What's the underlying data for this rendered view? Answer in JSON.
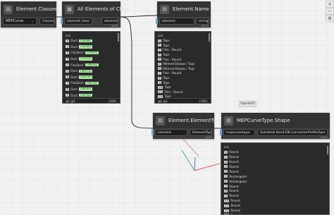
{
  "canvas": {
    "background": "#f1f1f1",
    "grid_line": "#e4e4e4",
    "wire_color": "#1a1a1a",
    "port_color": "#6aa6d9",
    "axis_colors": {
      "x": "#e03030",
      "y": "#30a050",
      "z": "#3050e0"
    }
  },
  "zoom_controls": [
    {
      "name": "zoom-in-icon",
      "glyph": "+"
    },
    {
      "name": "zoom-out-icon",
      "glyph": "−"
    },
    {
      "name": "fit-view-icon",
      "glyph": "⊕"
    }
  ],
  "tooltip": "OpenHEP",
  "nodes": {
    "element_classes": {
      "title": "Element Classes",
      "value": "MEPCurve",
      "output": "Classes"
    },
    "all_elements": {
      "title": "All Elements of Class",
      "input": "element class",
      "output": "elements",
      "lacing": "AUTO"
    },
    "element_name": {
      "title": "Element.Name",
      "input": "element",
      "output": "string",
      "lacing": "AUTO"
    },
    "element_type": {
      "title": "Element.ElementType",
      "input": "element",
      "output": "ElementType",
      "lacing": "AUTO"
    },
    "mep_shape": {
      "title": "MEPCurveType.Shape",
      "input": "mepcurvetype",
      "output": "Autodesk.Revit.DB.ConnectorProfileType",
      "lacing": "AUTO"
    }
  },
  "previews": {
    "elements": {
      "list_label": "List",
      "items": [
        {
          "index": "0",
          "text": "Duct",
          "tag": "1360662"
        },
        {
          "index": "1",
          "text": "Duct",
          "tag": "1360683"
        },
        {
          "index": "2",
          "text": "FlexDuct",
          "tag": "1379292"
        },
        {
          "index": "3",
          "text": "Duct",
          "tag": "1379376"
        },
        {
          "index": "4",
          "text": "FlexDuct",
          "tag": "1380483"
        },
        {
          "index": "5",
          "text": "Duct",
          "tag": "1385722"
        },
        {
          "index": "6",
          "text": "Duct",
          "tag": "1385765"
        },
        {
          "index": "7",
          "text": "FlexDuct",
          "tag": "1385785"
        },
        {
          "index": "8",
          "text": "Duct",
          "tag": "1385854"
        },
        {
          "index": "9",
          "text": "Duct",
          "tag": "1385905"
        }
      ],
      "footer_left": "@L @1",
      "footer_right": "{306}"
    },
    "names": {
      "list_label": "List",
      "items": [
        {
          "index": "0",
          "text": "Taps"
        },
        {
          "index": "1",
          "text": "Taps"
        },
        {
          "index": "2",
          "text": "Flex - Round"
        },
        {
          "index": "3",
          "text": "Taps"
        },
        {
          "index": "4",
          "text": "Flex - Round"
        },
        {
          "index": "5",
          "text": "Mitered Elbows / Taps"
        },
        {
          "index": "6",
          "text": "Mitered Elbows / Taps"
        },
        {
          "index": "7",
          "text": "Flex - Round"
        },
        {
          "index": "8",
          "text": "Taps"
        },
        {
          "index": "9",
          "text": "Taps"
        },
        {
          "index": "10",
          "text": "Taps"
        },
        {
          "index": "11",
          "text": "Flex - Round"
        },
        {
          "index": "12",
          "text": "Taps"
        }
      ],
      "footer_left": "@L @1",
      "footer_right": "{306}"
    },
    "shapes": {
      "list_label": "List",
      "items": [
        {
          "index": "0",
          "text": "Round"
        },
        {
          "index": "1",
          "text": "Round"
        },
        {
          "index": "2",
          "text": "Round"
        },
        {
          "index": "3",
          "text": "Round"
        },
        {
          "index": "4",
          "text": "Round"
        },
        {
          "index": "5",
          "text": "Rectangular"
        },
        {
          "index": "6",
          "text": "Rectangular"
        },
        {
          "index": "7",
          "text": "Round"
        },
        {
          "index": "8",
          "text": "Round"
        },
        {
          "index": "9",
          "text": "Round"
        },
        {
          "index": "10",
          "text": "Round"
        },
        {
          "index": "11",
          "text": "Round"
        },
        {
          "index": "12",
          "text": "Round"
        },
        {
          "index": "13",
          "text": "Round"
        }
      ],
      "footer_left": "@L @1",
      "footer_right": "{306}"
    }
  }
}
